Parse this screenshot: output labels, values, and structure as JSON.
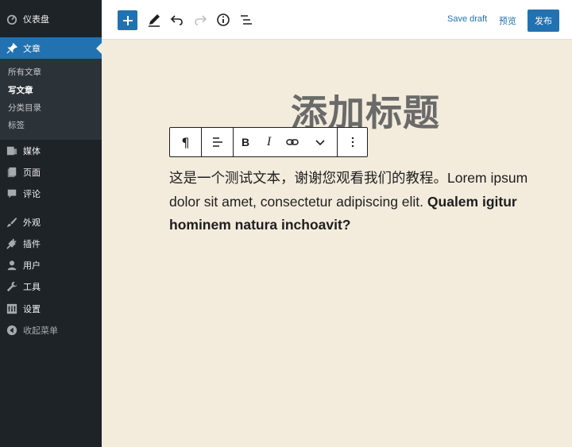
{
  "sidebar": {
    "dashboard": "仪表盘",
    "posts": "文章",
    "submenu": [
      "所有文章",
      "写文章",
      "分类目录",
      "标签"
    ],
    "media": "媒体",
    "pages": "页面",
    "comments": "评论",
    "appearance": "外观",
    "plugins": "插件",
    "users": "用户",
    "tools": "工具",
    "settings": "设置",
    "collapse": "收起菜单"
  },
  "topbar": {
    "save_draft": "Save draft",
    "preview": "预览",
    "publish": "发布"
  },
  "editor": {
    "title": "添加标题",
    "paragraph_plain": "这是一个测试文本，谢谢您观看我们的教程。Lorem ipsum dolor sit amet, consectetur adipiscing elit.",
    "paragraph_bold": "Qualem igitur hominem natura inchoavit?"
  },
  "block_toolbar": {
    "paragraph_symbol": "¶",
    "bold": "B",
    "italic": "I"
  },
  "colors": {
    "accent": "#2271b1",
    "sidebar_bg": "#1d2327",
    "canvas_bg": "#f3ecdd"
  }
}
